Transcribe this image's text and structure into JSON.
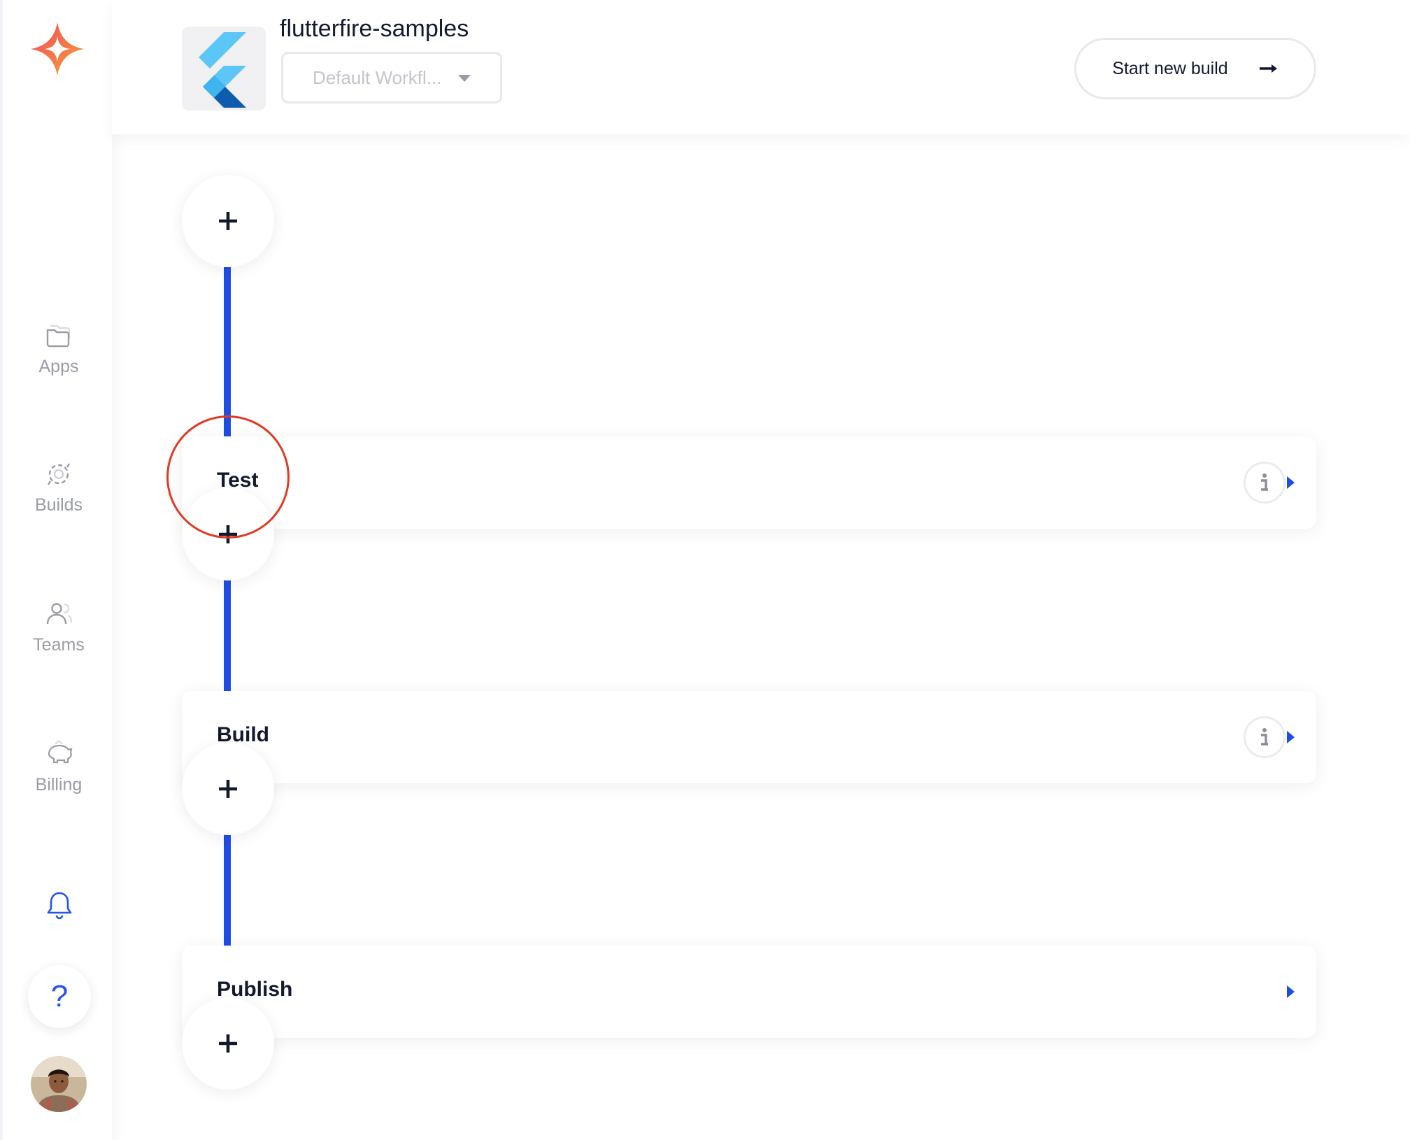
{
  "app": {
    "title": "flutterfire-samples",
    "workflow_selected": "Default Workfl...",
    "start_build_label": "Start new build"
  },
  "sidebar": {
    "items": [
      {
        "label": "Apps",
        "icon": "folder-icon"
      },
      {
        "label": "Builds",
        "icon": "builds-icon"
      },
      {
        "label": "Teams",
        "icon": "user-icon"
      },
      {
        "label": "Billing",
        "icon": "piggy-bank-icon"
      }
    ],
    "help_label": "?"
  },
  "stages": [
    {
      "label": "Test",
      "has_info": true
    },
    {
      "label": "Build",
      "has_info": true
    },
    {
      "label": "Publish",
      "has_info": false
    }
  ],
  "colors": {
    "accent": "#1f4de4",
    "highlight": "#e03a24",
    "text": "#141a2e",
    "muted": "#9a9ca6"
  }
}
